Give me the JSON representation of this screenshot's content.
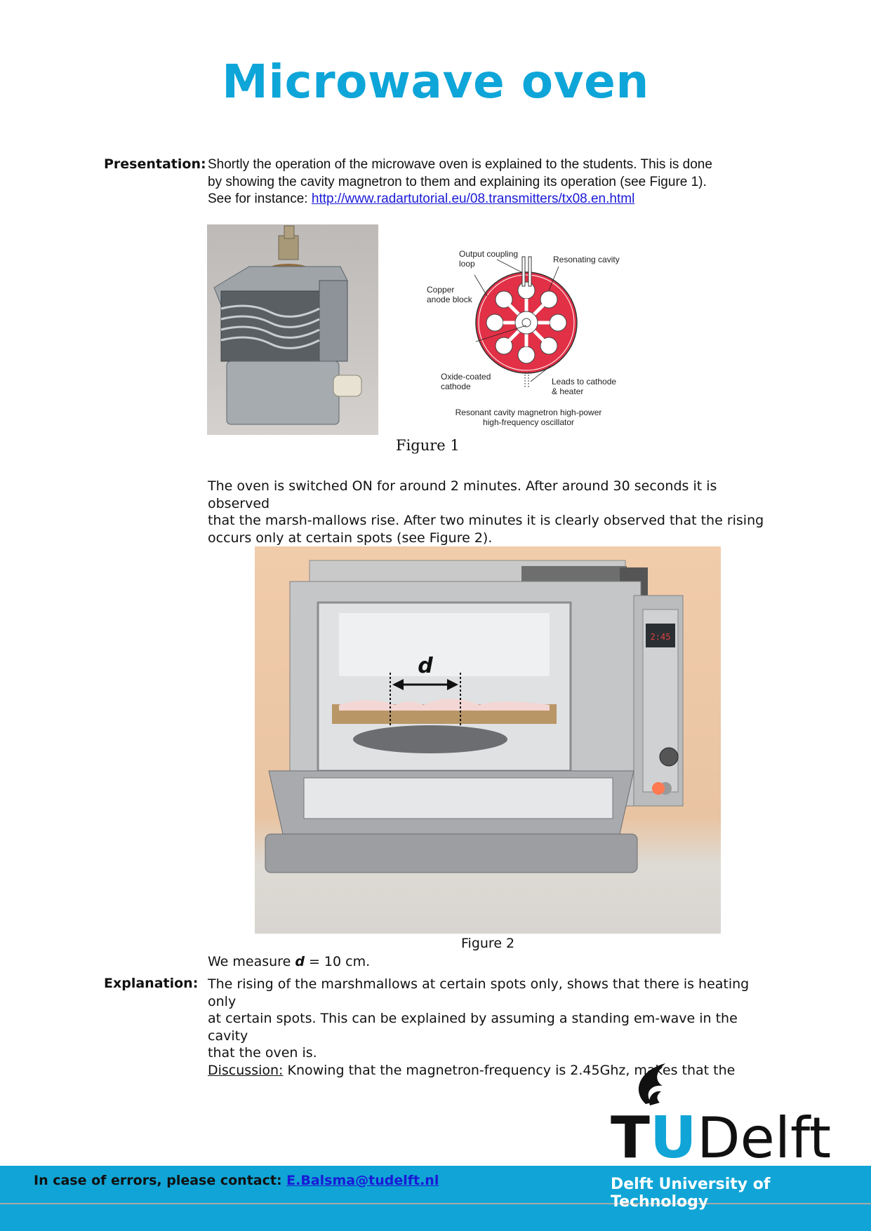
{
  "title": "Microwave oven",
  "presentation": {
    "label": "Presentation:",
    "line1": "Shortly the operation of the microwave oven is explained to the students. This is done",
    "line2": "by showing the cavity magnetron to them and explaining its operation (see Figure 1).",
    "see_prefix": "See for instance: ",
    "link": "http://www.radartutorial.eu/08.transmitters/tx08.en.html"
  },
  "diagram": {
    "output_coupling_1": "Output coupling",
    "output_coupling_2": "loop",
    "resonating_cavity": "Resonating cavity",
    "copper_1": "Copper",
    "copper_2": "anode block",
    "oxide_1": "Oxide-coated",
    "oxide_2": "cathode",
    "leads_1": "Leads to cathode",
    "leads_2": "& heater",
    "caption_1": "Resonant cavity magnetron high-power",
    "caption_2": "high-frequency oscillator"
  },
  "figure1_caption": "Figure 1",
  "observation": {
    "line1": "The oven is switched ON for around 2 minutes. After around 30 seconds it is observed",
    "line2": "that the marsh-mallows rise. After two minutes it is clearly observed that the rising",
    "line3": "occurs only at certain spots (see Figure 2)."
  },
  "figure2": {
    "d_label": "d",
    "display": "2:45",
    "caption": "Figure 2"
  },
  "measure": {
    "prefix": "We measure ",
    "symbol": "d",
    "suffix": " = 10 cm."
  },
  "explanation": {
    "label": "Explanation:",
    "line1": "The rising of the marshmallows at certain spots only, shows that there is heating only",
    "line2": "at certain spots. This can be explained by assuming a standing em-wave in the cavity",
    "line3": "that the oven is.",
    "discussion_label": "Discussion:",
    "discussion_text": " Knowing that the magnetron-frequency is 2.45Ghz, makes that the"
  },
  "logo": {
    "t": "T",
    "u": "U",
    "delft": "Delft",
    "university": "Delft University of Technology"
  },
  "footer": {
    "contact_prefix": "In case of errors, please contact: ",
    "email": "E.Balsma@tudelft.nl"
  },
  "colors": {
    "title": "#0ea5d8",
    "footer_bar": "#10a5d6",
    "link": "#1a1ad6",
    "magnetron_red": "#e23046"
  }
}
